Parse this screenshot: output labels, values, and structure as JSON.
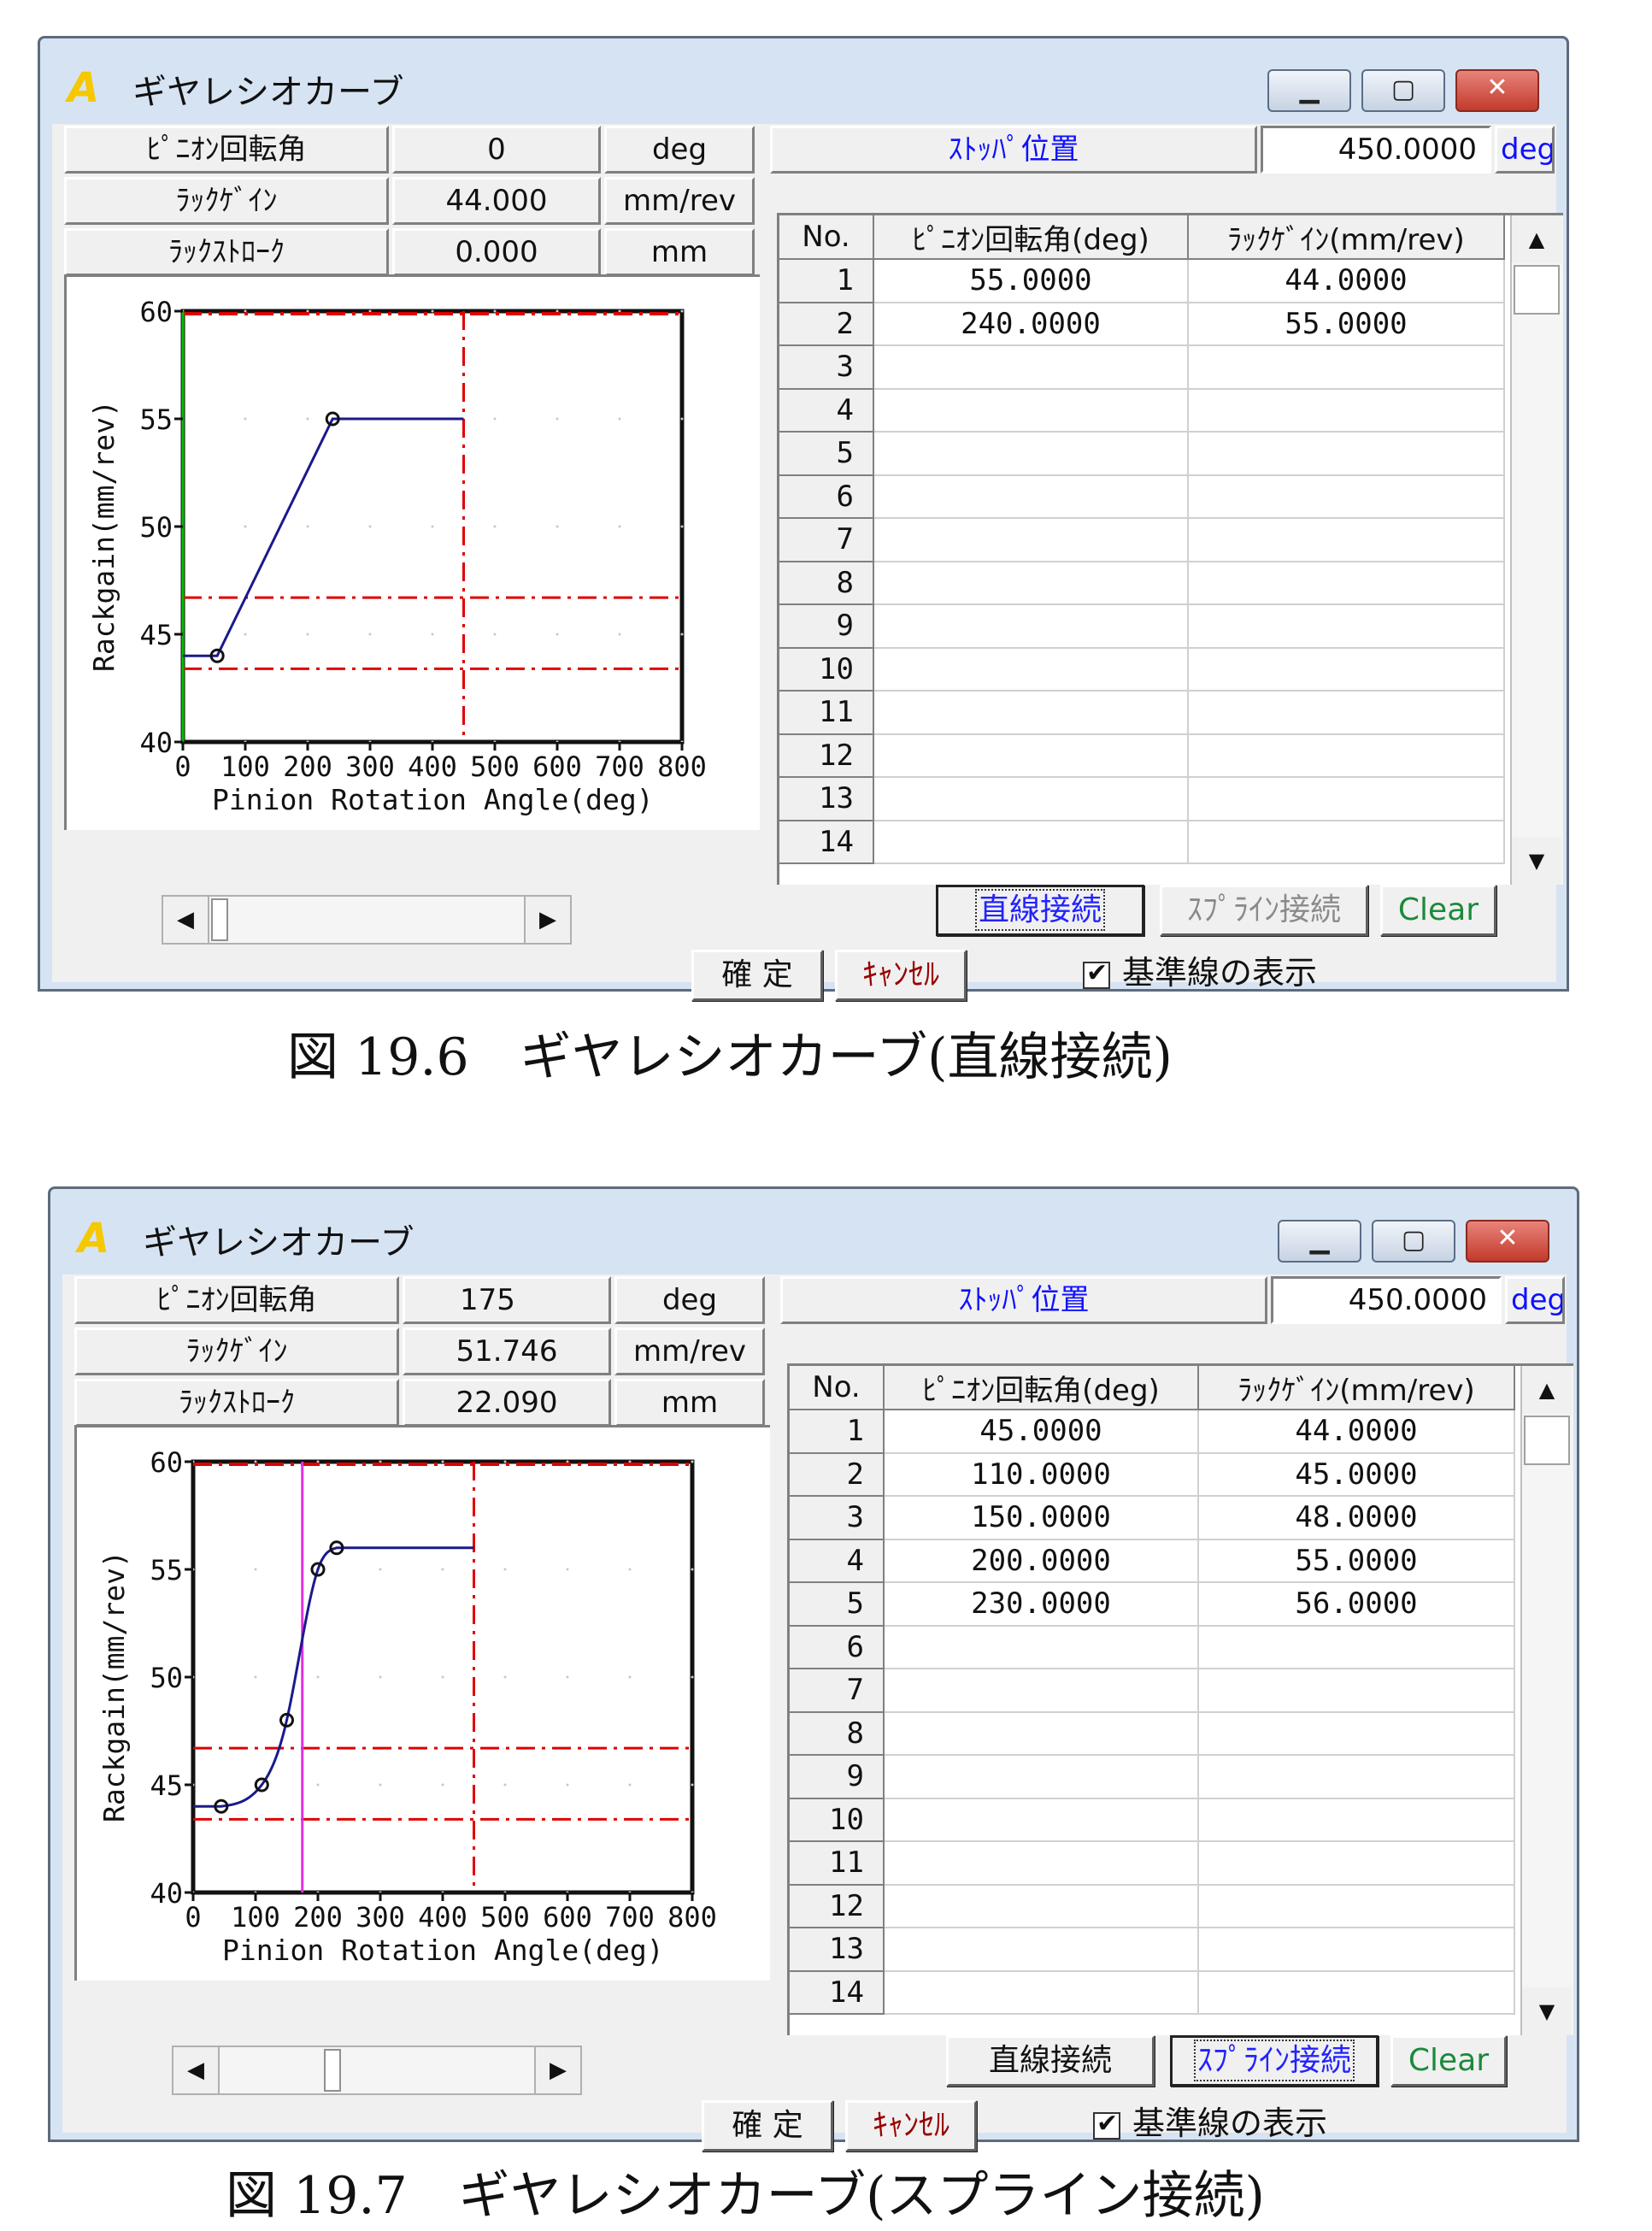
{
  "colors": {
    "accent_blue": "#1010ff",
    "grid_red": "#e00000",
    "curve": "#1a1a8c",
    "cursor_magenta": "#e030e0",
    "axis_green": "#00c000"
  },
  "figures": [
    {
      "title": "ギヤレシオカーブ",
      "caption": "図 19.6　ギヤレシオカーブ(直線接続)",
      "fields": {
        "pinion_label": "ﾋﾟﾆｵﾝ回転角",
        "pinion_value": "0",
        "pinion_unit": "deg",
        "rackgain_label": "ﾗｯｸｹﾞｲﾝ",
        "rackgain_value": "44.000",
        "rackgain_unit": "mm/rev",
        "rackstroke_label": "ﾗｯｸｽﾄﾛｰｸ",
        "rackstroke_value": "0.000",
        "rackstroke_unit": "mm",
        "stopper_label": "ｽﾄｯﾊﾟ位置",
        "stopper_value": "450.0000",
        "stopper_unit": "deg"
      },
      "table": {
        "headers": [
          "No.",
          "ﾋﾟﾆｵﾝ回転角(deg)",
          "ﾗｯｸｹﾞｲﾝ(mm/rev)"
        ],
        "rows": [
          [
            "1",
            "55.0000",
            "44.0000"
          ],
          [
            "2",
            "240.0000",
            "55.0000"
          ],
          [
            "3",
            "",
            ""
          ],
          [
            "4",
            "",
            ""
          ],
          [
            "5",
            "",
            ""
          ],
          [
            "6",
            "",
            ""
          ],
          [
            "7",
            "",
            ""
          ],
          [
            "8",
            "",
            ""
          ],
          [
            "9",
            "",
            ""
          ],
          [
            "10",
            "",
            ""
          ],
          [
            "11",
            "",
            ""
          ],
          [
            "12",
            "",
            ""
          ],
          [
            "13",
            "",
            ""
          ],
          [
            "14",
            "",
            ""
          ]
        ]
      },
      "buttons": {
        "linear": "直線接続",
        "spline": "ｽﾌﾟﾗｲﾝ接続",
        "clear": "Clear",
        "ok": "確 定",
        "cancel": "ｷｬﾝｾﾙ",
        "active": "linear"
      },
      "checkbox_label": "基準線の表示",
      "chart_data": {
        "type": "line",
        "xlabel": "Pinion Rotation Angle(deg)",
        "ylabel": "Rackgain(mm/rev)",
        "xlim": [
          0,
          800
        ],
        "ylim": [
          40,
          60
        ],
        "xticks": [
          0,
          100,
          200,
          300,
          400,
          500,
          600,
          700,
          800
        ],
        "yticks": [
          40,
          45,
          50,
          55,
          60
        ],
        "interpolation": "linear",
        "points": [
          [
            55,
            44
          ],
          [
            240,
            55
          ]
        ],
        "curve_end_x": 450,
        "stopper_x": 450,
        "reference_y": [
          46.7,
          43.4
        ],
        "cursor_x": 0
      }
    },
    {
      "title": "ギヤレシオカーブ",
      "caption": "図 19.7　ギヤレシオカーブ(スプライン接続)",
      "fields": {
        "pinion_label": "ﾋﾟﾆｵﾝ回転角",
        "pinion_value": "175",
        "pinion_unit": "deg",
        "rackgain_label": "ﾗｯｸｹﾞｲﾝ",
        "rackgain_value": "51.746",
        "rackgain_unit": "mm/rev",
        "rackstroke_label": "ﾗｯｸｽﾄﾛｰｸ",
        "rackstroke_value": "22.090",
        "rackstroke_unit": "mm",
        "stopper_label": "ｽﾄｯﾊﾟ位置",
        "stopper_value": "450.0000",
        "stopper_unit": "deg"
      },
      "table": {
        "headers": [
          "No.",
          "ﾋﾟﾆｵﾝ回転角(deg)",
          "ﾗｯｸｹﾞｲﾝ(mm/rev)"
        ],
        "rows": [
          [
            "1",
            "45.0000",
            "44.0000"
          ],
          [
            "2",
            "110.0000",
            "45.0000"
          ],
          [
            "3",
            "150.0000",
            "48.0000"
          ],
          [
            "4",
            "200.0000",
            "55.0000"
          ],
          [
            "5",
            "230.0000",
            "56.0000"
          ],
          [
            "6",
            "",
            ""
          ],
          [
            "7",
            "",
            ""
          ],
          [
            "8",
            "",
            ""
          ],
          [
            "9",
            "",
            ""
          ],
          [
            "10",
            "",
            ""
          ],
          [
            "11",
            "",
            ""
          ],
          [
            "12",
            "",
            ""
          ],
          [
            "13",
            "",
            ""
          ],
          [
            "14",
            "",
            ""
          ]
        ]
      },
      "buttons": {
        "linear": "直線接続",
        "spline": "ｽﾌﾟﾗｲﾝ接続",
        "clear": "Clear",
        "ok": "確 定",
        "cancel": "ｷｬﾝｾﾙ",
        "active": "spline"
      },
      "checkbox_label": "基準線の表示",
      "chart_data": {
        "type": "line",
        "xlabel": "Pinion Rotation Angle(deg)",
        "ylabel": "Rackgain(mm/rev)",
        "xlim": [
          0,
          800
        ],
        "ylim": [
          40,
          60
        ],
        "xticks": [
          0,
          100,
          200,
          300,
          400,
          500,
          600,
          700,
          800
        ],
        "yticks": [
          40,
          45,
          50,
          55,
          60
        ],
        "interpolation": "spline",
        "points": [
          [
            45,
            44
          ],
          [
            110,
            45
          ],
          [
            150,
            48
          ],
          [
            200,
            55
          ],
          [
            230,
            56
          ]
        ],
        "curve_end_x": 450,
        "stopper_x": 450,
        "reference_y": [
          46.7,
          43.4
        ],
        "cursor_x": 175
      }
    }
  ]
}
